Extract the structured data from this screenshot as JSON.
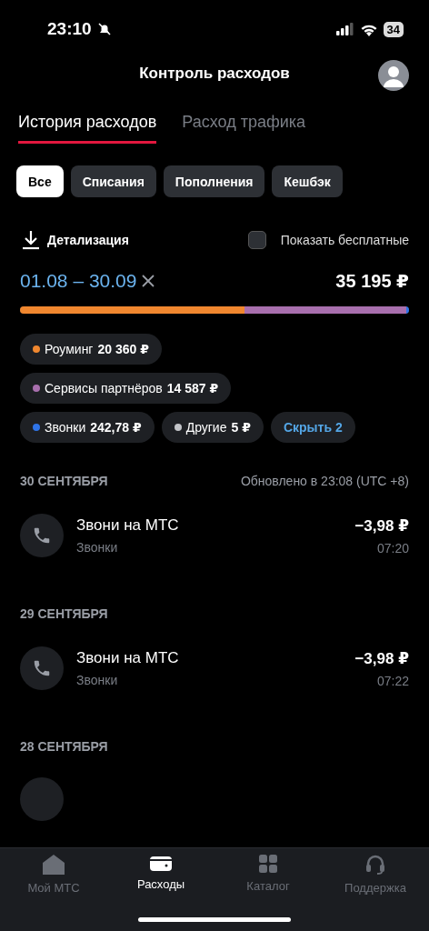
{
  "status_bar": {
    "time": "23:10",
    "battery": "34"
  },
  "header": {
    "title": "Контроль расходов"
  },
  "tabs": [
    {
      "label": "История расходов",
      "selected": true
    },
    {
      "label": "Расход трафика",
      "selected": false
    }
  ],
  "filters": [
    {
      "label": "Все",
      "selected": true
    },
    {
      "label": "Списания",
      "selected": false
    },
    {
      "label": "Пополнения",
      "selected": false
    },
    {
      "label": "Кешбэк",
      "selected": false
    }
  ],
  "details_link": "Детализация",
  "show_free": {
    "label": "Показать бесплатные",
    "checked": false
  },
  "period": {
    "range": "01.08 – 30.09",
    "total": "35 195 ₽"
  },
  "breakdown_bar": [
    {
      "color": "#f0872f",
      "level": 0.578
    },
    {
      "color": "#a86fad",
      "level": 0.414
    },
    {
      "color": "#2f74e8",
      "level": 0.008
    }
  ],
  "categories": [
    {
      "name": "Роуминг",
      "amount": "20 360 ₽",
      "color": "#f0872f"
    },
    {
      "name": "Сервисы партнёров",
      "amount": "14 587 ₽",
      "color": "#a86fad"
    },
    {
      "name": "Звонки",
      "amount": "242,78 ₽",
      "color": "#2f74e8"
    },
    {
      "name": "Другие",
      "amount": "5 ₽",
      "color": "#c2c4c8"
    }
  ],
  "hide_button": "Скрыть 2",
  "days": [
    {
      "date": "30 СЕНТЯБРЯ",
      "updated": "Обновлено в 23:08 (UTC +8)",
      "items": [
        {
          "title": "Звони на МТС",
          "category": "Звонки",
          "amount": "−3,98 ₽",
          "time": "07:20"
        }
      ]
    },
    {
      "date": "29 СЕНТЯБРЯ",
      "items": [
        {
          "title": "Звони на МТС",
          "category": "Звонки",
          "amount": "−3,98 ₽",
          "time": "07:22"
        }
      ]
    },
    {
      "date": "28 СЕНТЯБРЯ"
    }
  ],
  "bottom_nav": [
    {
      "label": "Мой МТС",
      "kind": "home",
      "selected": false
    },
    {
      "label": "Расходы",
      "kind": "wallet",
      "selected": true
    },
    {
      "label": "Каталог",
      "kind": "grid",
      "selected": false
    },
    {
      "label": "Поддержка",
      "kind": "headset",
      "selected": false
    }
  ]
}
